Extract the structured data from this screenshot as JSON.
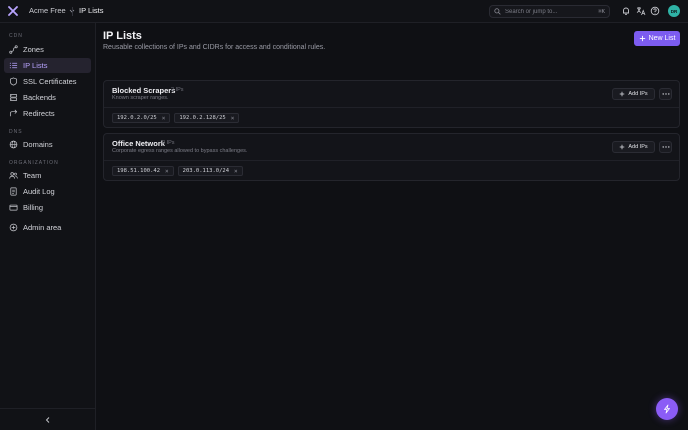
{
  "colors": {
    "accent": "#7c5cf0",
    "active_text": "#b9a4ff",
    "avatar": "#2fb3a6"
  },
  "topbar": {
    "org_name": "Acme Free",
    "breadcrumb": "IP Lists",
    "search_placeholder": "Search or jump to...",
    "search_shortcut": "⌘K",
    "avatar_initials": "DR",
    "icons": [
      "bell-icon",
      "translate-icon",
      "help-icon"
    ]
  },
  "sidebar": {
    "sections": [
      {
        "label": "CDN",
        "items": [
          {
            "label": "Zones",
            "icon": "zones-icon"
          },
          {
            "label": "IP Lists",
            "icon": "list-icon",
            "active": true
          },
          {
            "label": "SSL Certificates",
            "icon": "shield-icon"
          },
          {
            "label": "Backends",
            "icon": "server-icon"
          },
          {
            "label": "Redirects",
            "icon": "redirect-icon"
          }
        ]
      },
      {
        "label": "DNS",
        "items": [
          {
            "label": "Domains",
            "icon": "globe-icon"
          }
        ]
      },
      {
        "label": "ORGANIZATION",
        "items": [
          {
            "label": "Team",
            "icon": "users-icon"
          },
          {
            "label": "Audit Log",
            "icon": "log-icon"
          },
          {
            "label": "Billing",
            "icon": "card-icon"
          }
        ]
      }
    ],
    "admin": {
      "label": "Admin area",
      "icon": "admin-icon"
    }
  },
  "main": {
    "title": "IP Lists",
    "subtitle": "Reusable collections of IPs and CIDRs for access and conditional rules.",
    "new_button": "New List",
    "lists": [
      {
        "name": "Blocked Scrapers",
        "count": "2 IPs",
        "description": "Known scraper ranges.",
        "add_label": "Add IPs",
        "entries": [
          "192.0.2.0/25",
          "192.0.2.128/25"
        ]
      },
      {
        "name": "Office Network",
        "count": "2 IPs",
        "description": "Corporate egress ranges allowed to bypass challenges.",
        "add_label": "Add IPs",
        "entries": [
          "198.51.100.42",
          "203.0.113.0/24"
        ]
      }
    ]
  }
}
